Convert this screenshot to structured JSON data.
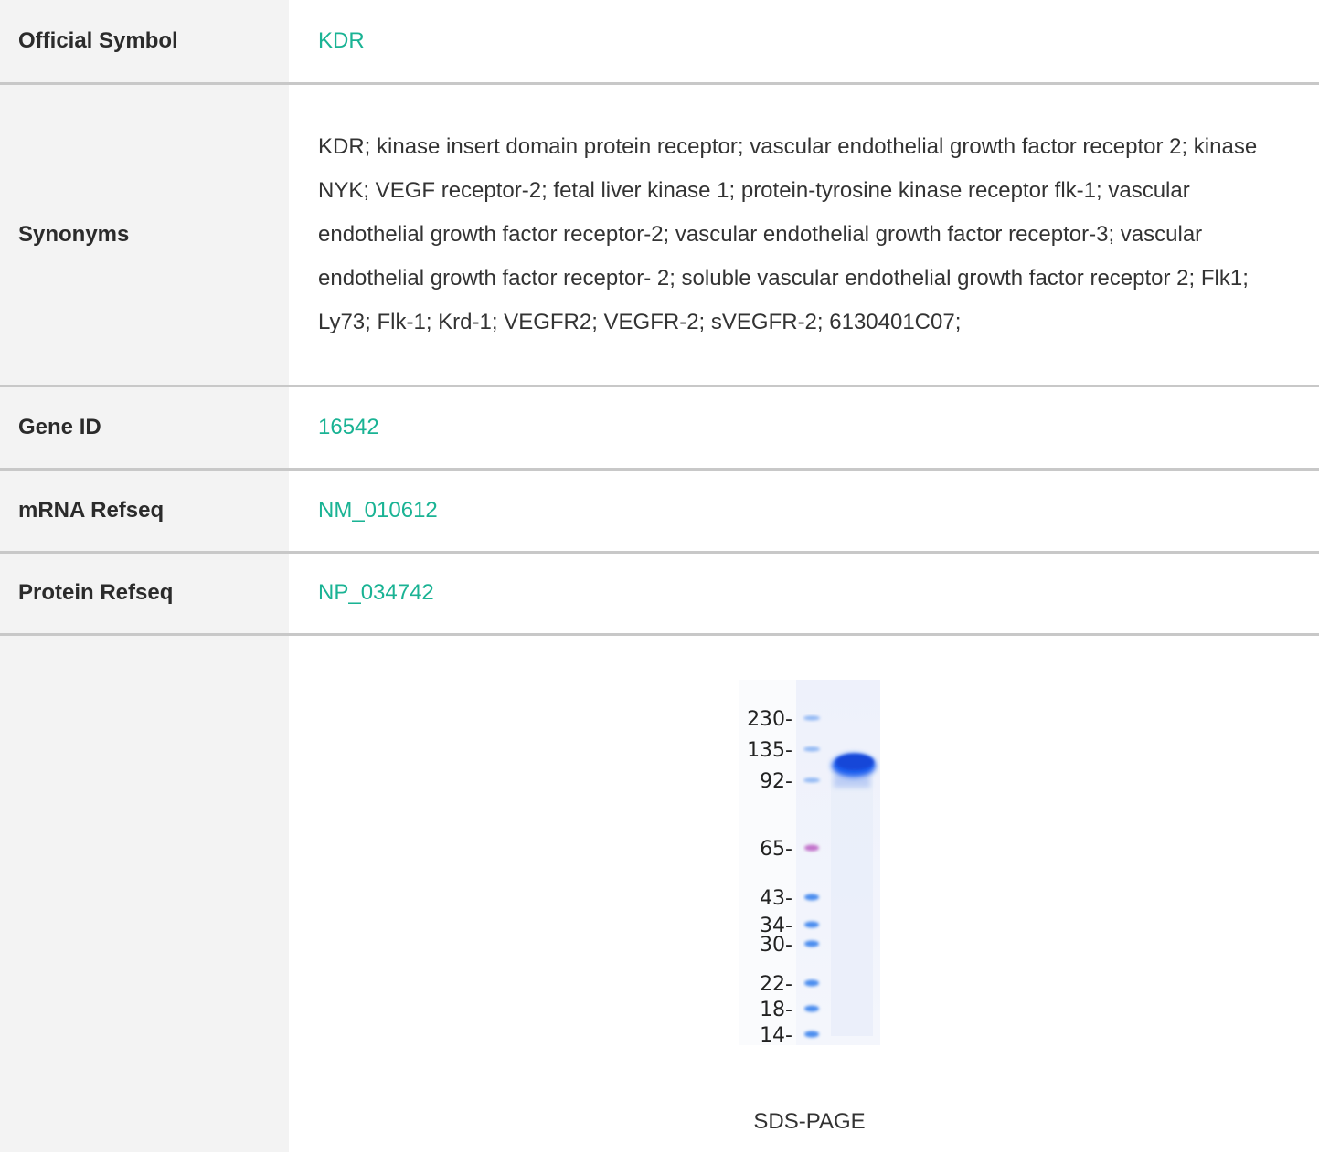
{
  "rows": {
    "official_symbol": {
      "label": "Official Symbol",
      "value": "KDR"
    },
    "synonyms": {
      "label": "Synonyms",
      "value": "KDR; kinase insert domain protein receptor; vascular endothelial growth factor receptor 2; kinase NYK; VEGF receptor-2; fetal liver kinase 1; protein-tyrosine kinase receptor flk-1; vascular endothelial growth factor receptor-2; vascular endothelial growth factor receptor-3; vascular endothelial growth factor receptor- 2; soluble vascular endothelial growth factor receptor 2; Flk1; Ly73; Flk-1; Krd-1; VEGFR2; VEGFR-2; sVEGFR-2; 6130401C07;"
    },
    "gene_id": {
      "label": "Gene ID",
      "value": "16542"
    },
    "mrna_refseq": {
      "label": "mRNA Refseq",
      "value": "NM_010612"
    },
    "protein_refseq": {
      "label": "Protein Refseq",
      "value": "NP_034742"
    }
  },
  "figure": {
    "caption": "SDS-PAGE",
    "markers": [
      "230-",
      "135-",
      "92-",
      "65-",
      "43-",
      "34-",
      "30-",
      "22-",
      "18-",
      "14-"
    ]
  },
  "colors": {
    "link": "#1ab394",
    "label_bg": "#f3f3f3",
    "border": "#c8c8c8",
    "band": "#1f5ff0",
    "marker_blue": "#3f86ee",
    "marker_pink": "#c06bc8"
  }
}
